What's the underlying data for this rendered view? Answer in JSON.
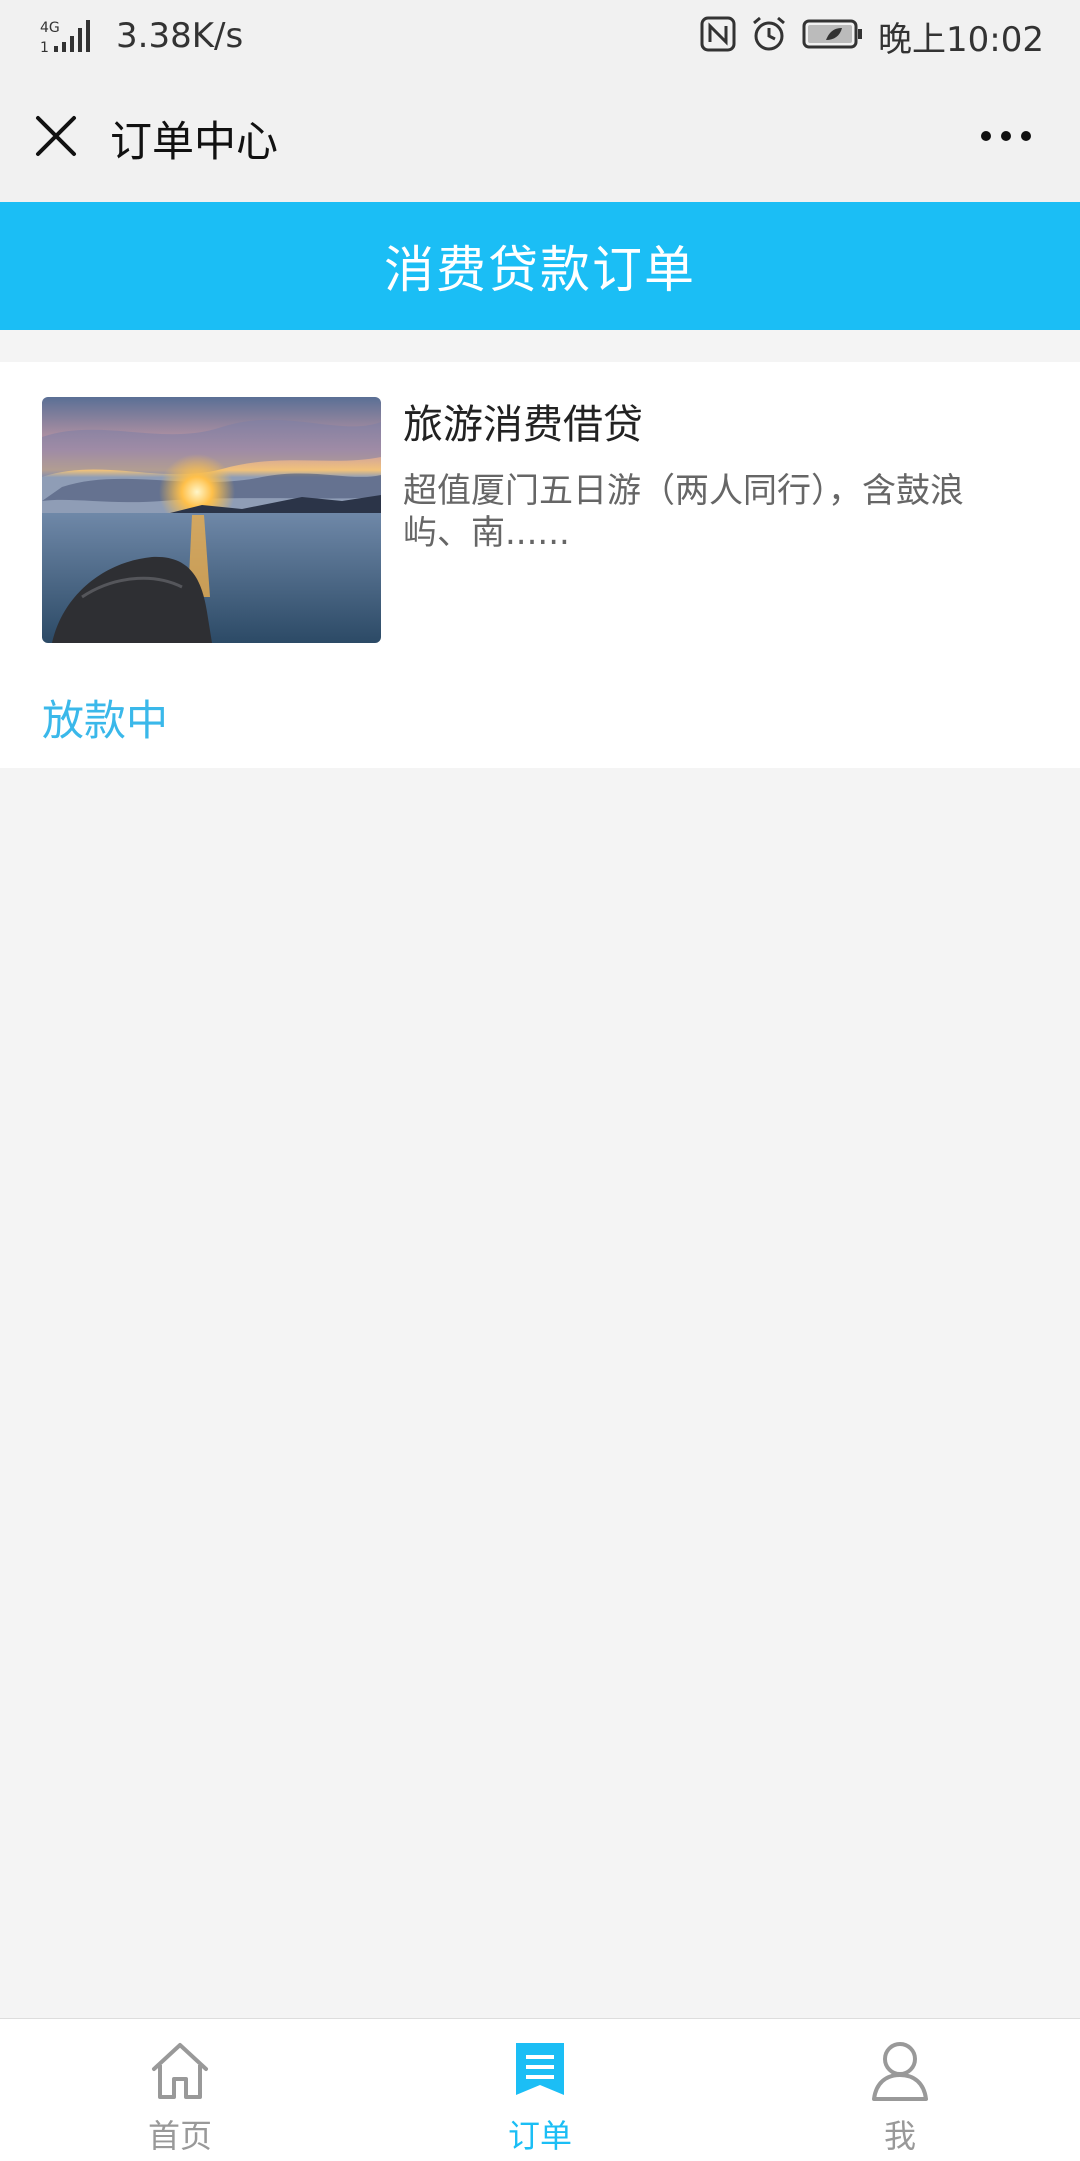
{
  "status_bar": {
    "network_type": "4G",
    "net_speed": "3.38K/s",
    "time": "晚上10:02",
    "icons": [
      "signal-icon",
      "nfc-icon",
      "alarm-icon",
      "battery-icon"
    ]
  },
  "nav": {
    "title": "订单中心",
    "close_icon": "close-icon",
    "more_icon": "more-icon"
  },
  "banner": {
    "title": "消费贷款订单",
    "color": "#1bbef5"
  },
  "orders": [
    {
      "name": "旅游消费借贷",
      "description": "超值厦门五日游（两人同行），含鼓浪屿、南......",
      "status": "放款中",
      "status_color": "#3ab8ea",
      "thumbnail": "sunset-seascape-image"
    }
  ],
  "tab_bar": {
    "active_index": 1,
    "accent_color": "#1bbef5",
    "tabs": [
      {
        "label": "首页",
        "icon": "home-icon"
      },
      {
        "label": "订单",
        "icon": "order-icon"
      },
      {
        "label": "我",
        "icon": "profile-icon"
      }
    ]
  }
}
